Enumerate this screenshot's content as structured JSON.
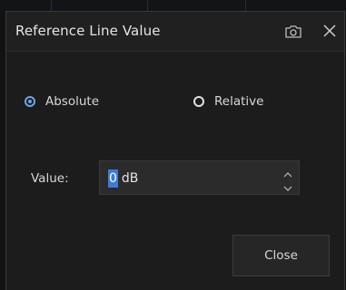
{
  "dialog": {
    "title": "Reference Line Value",
    "camera_icon": "camera-icon",
    "close_icon": "close-icon"
  },
  "mode": {
    "options": [
      {
        "label": "Absolute",
        "selected": true
      },
      {
        "label": "Relative",
        "selected": false
      }
    ]
  },
  "value": {
    "label": "Value:",
    "number": "0",
    "unit": "dB"
  },
  "buttons": {
    "close_label": "Close"
  },
  "colors": {
    "accent": "#6fa3e6",
    "selection": "#3d7bd8",
    "dialog_bg": "#1c1c1c"
  }
}
